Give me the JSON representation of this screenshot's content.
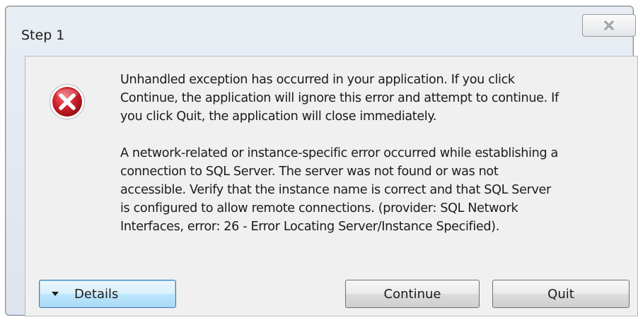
{
  "window": {
    "title": "Step 1",
    "close_icon": "close-icon"
  },
  "dialog": {
    "icon": "error-icon",
    "message_lines": [
      "Unhandled exception has occurred in your application. If you click",
      "Continue, the application will ignore this error and attempt to continue. If",
      "you click Quit, the application will close immediately."
    ],
    "detail_lines": [
      "A network-related or instance-specific error occurred while establishing a",
      "connection to SQL Server. The server was not found or was not",
      "accessible. Verify that the instance name is correct and that SQL Server",
      "is configured to allow remote connections. (provider: SQL Network",
      "Interfaces, error: 26 - Error Locating Server/Instance Specified)."
    ]
  },
  "buttons": {
    "details_label": "Details",
    "details_icon": "chevron-down-icon",
    "continue_label": "Continue",
    "quit_label": "Quit"
  },
  "colors": {
    "error_red": "#c8102e",
    "focus_blue": "#3c7fb1"
  }
}
